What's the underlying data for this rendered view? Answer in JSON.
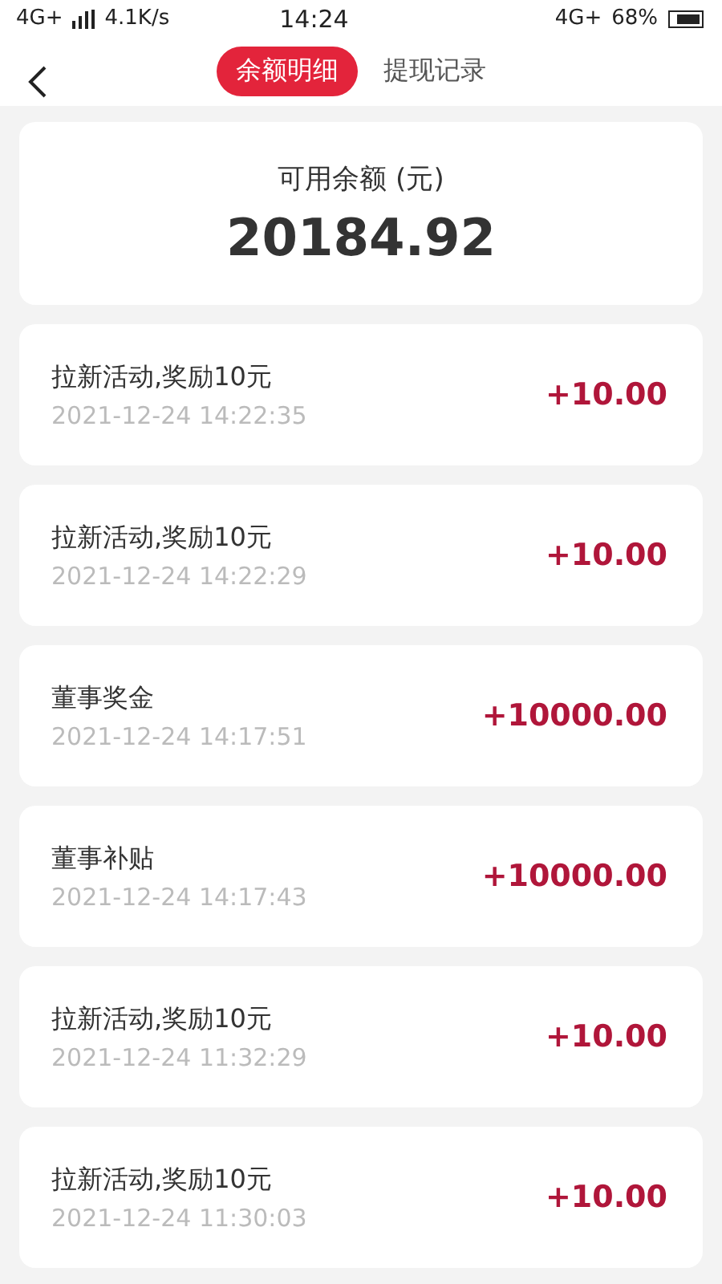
{
  "status_bar": {
    "network": "4G+",
    "speed": "4.1K/s",
    "time": "14:24",
    "network_right": "4G+",
    "battery": "68%"
  },
  "tabs": [
    {
      "label": "余额明细",
      "selected": true
    },
    {
      "label": "提现记录",
      "selected": false
    }
  ],
  "balance": {
    "label": "可用余额 (元)",
    "amount": "20184.92"
  },
  "records": [
    {
      "title": "拉新活动,奖励10元",
      "time": "2021-12-24 14:22:35",
      "amount": "+10.00"
    },
    {
      "title": "拉新活动,奖励10元",
      "time": "2021-12-24 14:22:29",
      "amount": "+10.00"
    },
    {
      "title": "董事奖金",
      "time": "2021-12-24 14:17:51",
      "amount": "+10000.00"
    },
    {
      "title": "董事补贴",
      "time": "2021-12-24 14:17:43",
      "amount": "+10000.00"
    },
    {
      "title": "拉新活动,奖励10元",
      "time": "2021-12-24 11:32:29",
      "amount": "+10.00"
    },
    {
      "title": "拉新活动,奖励10元",
      "time": "2021-12-24 11:30:03",
      "amount": "+10.00"
    }
  ]
}
